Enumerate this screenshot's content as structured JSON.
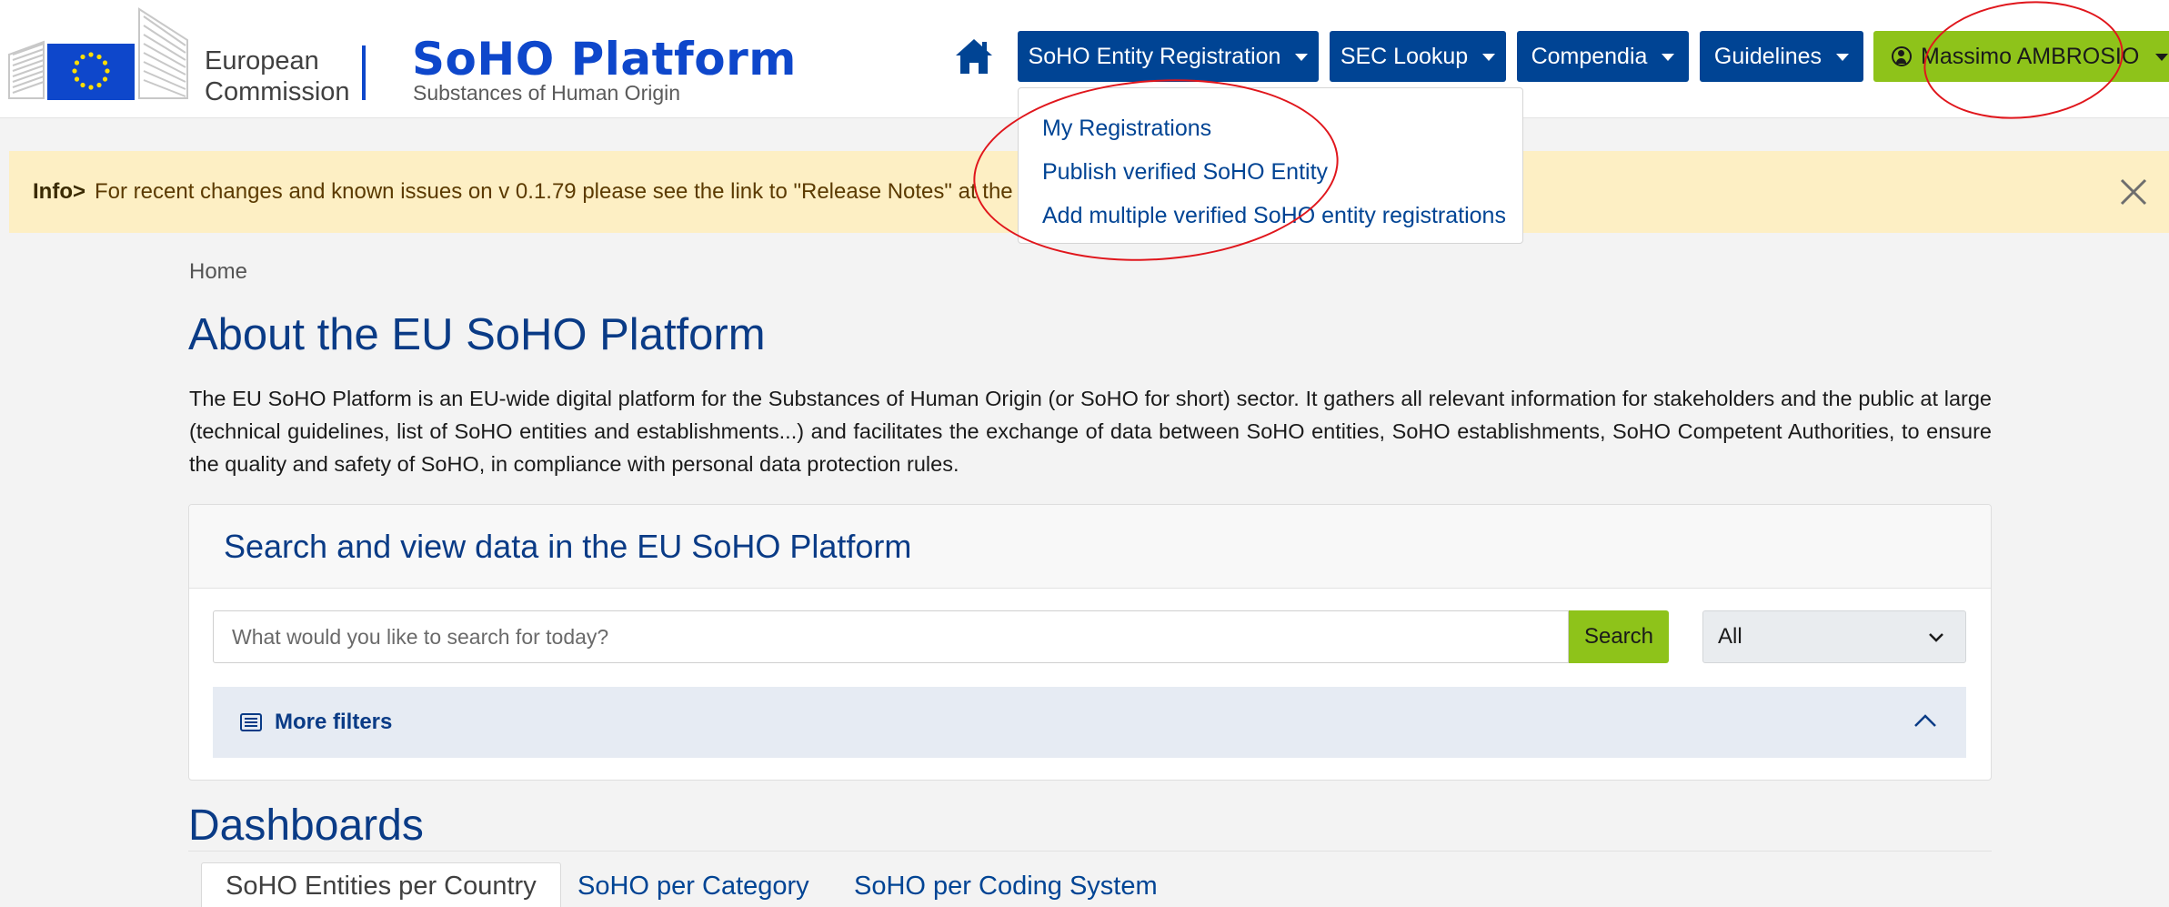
{
  "header": {
    "logo_line1": "European",
    "logo_line2": "Commission",
    "brand_title": "SoHO Platform",
    "brand_subtitle": "Substances of Human Origin",
    "nav": [
      {
        "label": "SoHO Entity Registration"
      },
      {
        "label": "SEC Lookup"
      },
      {
        "label": "Compendia"
      },
      {
        "label": "Guidelines"
      }
    ],
    "user_name": "Massimo AMBROSIO"
  },
  "dropdown": {
    "items": [
      "My Registrations",
      "Publish verified SoHO Entity",
      "Add multiple verified SoHO entity registrations"
    ]
  },
  "info_bar": {
    "prefix": "Info>",
    "text": "For recent changes and known issues on v 0.1.79 please see the link to \"Release Notes\" at the"
  },
  "breadcrumb": "Home",
  "page_title": "About the EU SoHO Platform",
  "intro": "The EU SoHO Platform is an EU-wide digital platform for the Substances of Human Origin (or SoHO for short) sector. It gathers all relevant information for stakeholders and the public at large (technical guidelines, list of SoHO entities and establishments...) and facilitates the exchange of data between SoHO entities, SoHO establishments, SoHO Competent Authorities, to ensure the quality and safety of SoHO, in compliance with personal data protection rules.",
  "search": {
    "title": "Search and view data in the EU SoHO Platform",
    "placeholder": "What would you like to search for today?",
    "button": "Search",
    "scope_selected": "All",
    "more_filters": "More filters"
  },
  "dashboards": {
    "title": "Dashboards",
    "tabs": [
      "SoHO Entities per Country",
      "SoHO per Category",
      "SoHO per Coding System"
    ]
  },
  "colors": {
    "primary": "#004494",
    "accent_green": "#8ec31a",
    "brand_blue": "#0e47cb",
    "info_bg": "#fdefc4",
    "annotation_red": "#e0161c"
  }
}
